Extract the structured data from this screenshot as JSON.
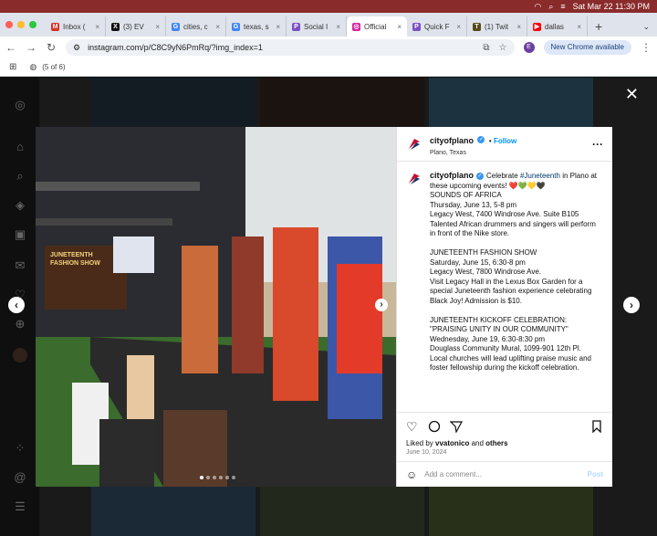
{
  "menubar": {
    "date_time": "Sat Mar 22  11:30 PM"
  },
  "tabs": [
    {
      "label": "Inbox (",
      "color": "#d93025",
      "glyph": "M"
    },
    {
      "label": "(3) EV",
      "color": "#111111",
      "glyph": "X"
    },
    {
      "label": "cities, c",
      "color": "#4285f4",
      "glyph": "G"
    },
    {
      "label": "texas, s",
      "color": "#4285f4",
      "glyph": "G"
    },
    {
      "label": "Social I",
      "color": "#7b4fc4",
      "glyph": "P"
    },
    {
      "label": "Official",
      "color": "#d6249f",
      "glyph": "◎"
    },
    {
      "label": "Quick F",
      "color": "#7b4fc4",
      "glyph": "P"
    },
    {
      "label": "(1) Twit",
      "color": "#5a4a1a",
      "glyph": "T"
    },
    {
      "label": "dallas ",
      "color": "#ff0000",
      "glyph": "▶"
    }
  ],
  "address": {
    "url": "instagram.com/p/C8C9yN6PmRq/?img_index=1",
    "chrome_available": "New Chrome available",
    "profile_initial": "E"
  },
  "bookmarks": {
    "counter": "(5 of 6)"
  },
  "post": {
    "account": "cityofplano",
    "follow": "Follow",
    "location": "Plano, Texas",
    "caption_intro": "Celebrate ",
    "hashtag": "#Juneteenth",
    "caption_rest": " in Plano at these upcoming events! ❤️💚💛🖤",
    "body": "SOUNDS OF AFRICA\nThursday, June 13, 5-8 pm\nLegacy West, 7400 Windrose Ave. Suite B105\nTalented African drummers and singers will perform in front of the Nike store.\n\nJUNETEENTH FASHION SHOW\nSaturday, June 15, 6:30-8 pm\nLegacy West, 7800 Windrose Ave.\nVisit Legacy Hall in the Lexus Box Garden for a special Juneteenth fashion experience celebrating Black Joy! Admission is $10.\n\nJUNETEENTH KICKOFF CELEBRATION:\n\"PRAISING UNITY IN OUR COMMUNITY\"\nWednesday, June 19, 6:30-8:30 pm\nDouglass Community Mural, 1099-901 12th Pl.\nLocal churches will lead uplifting praise music and foster fellowship during the kickoff celebration.",
    "liked_by_prefix": "Liked by ",
    "liked_by_user": "vvatonico",
    "liked_by_mid": " and ",
    "liked_by_others": "others",
    "date": "June 10, 2024",
    "comment_placeholder": "Add a comment...",
    "post_button": "Post",
    "stage_sign_line1": "JUNETEENTH",
    "stage_sign_line2": "FASHION SHOW"
  }
}
